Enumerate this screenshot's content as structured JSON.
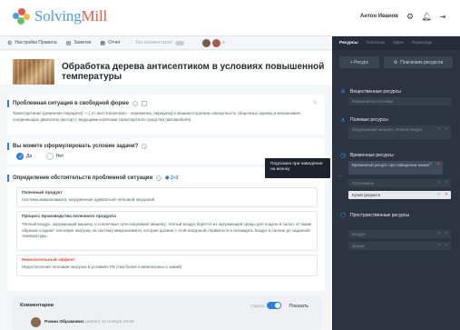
{
  "brand": {
    "name_a": "Solving",
    "name_b": "Mill"
  },
  "user": {
    "name": "Антон Иванов"
  },
  "toolbar": {
    "settings": "Настройки Правила",
    "notes": "Заметки",
    "report": "Отчет",
    "comments": "Без комментария"
  },
  "page": {
    "title": "Обработка дерева антисептиком в условиях повышенной температуры"
  },
  "problem": {
    "heading": "Проблемная ситуация в свободной форме",
    "text": "Транспортиная (ременная передача) — [ от англ.transmissio - переменна, передача] в машиностроении совокупность сборочных единиц и механизмов, соединяющих двигатель (мотор) с ведущими колёсами транспортного средства (автомобиля)."
  },
  "question": {
    "heading": "Вы можете сформулировать условие задачи?",
    "yes": "Да",
    "no": "Нет"
  },
  "circumstances": {
    "heading": "Определение обстоятельств проблемной ситуации",
    "counter": "2+3",
    "items": [
      {
        "title": "Полезный продукт",
        "text": "Система микроклимата, нагруженная адекватной тепловой нагрузкой"
      },
      {
        "title": "Процесс производства полезного продукта",
        "text": "Тёплый воздух, окружающий машину, и солнечные лучи нагревают машину; тёплый воздух берётся из окружающей среды для подачи в салон. И таким образом создают тепловую нагрузку на систему микроклимата, которая должна с этой нагрузкой справиться и охлаждать воздух в салоне до заданной температуры."
      },
      {
        "title": "Нежелательный эффект",
        "text": "Недостаточная тепловая нагрузка в условиях РБ (тем более в межсезонье и зимой)"
      }
    ]
  },
  "comments": {
    "heading": "Комментарии",
    "hide": "Скрыть",
    "show": "Показать",
    "author": "Роман Обрамович",
    "role": "(admin)",
    "date": "12 ноября 19:59"
  },
  "tooltip": {
    "text": "Подсказка при наведении на иконку"
  },
  "right_panel": {
    "tabs": [
      "Ресурсы",
      "Гипотезы",
      "Идеи",
      "Переходы"
    ],
    "add_resource": "+ Ресурс",
    "resource_finder": "Поисковик ресурсов",
    "sections": [
      {
        "title": "Вещественные ресурсы",
        "items": [
          "Компоненты системы"
        ]
      },
      {
        "title": "Полевые ресурсы",
        "items": [
          "Окружающий машину тёплый воздух"
        ]
      },
      {
        "title": "Временные ресурсы",
        "items": [
          "Временной ресурс при наведении мыши",
          "Пассажиры",
          "Кузов (редакти"
        ]
      },
      {
        "title": "Пространственные ресурсы",
        "items": [
          "Воздух",
          "Дожди"
        ]
      }
    ]
  },
  "colors": {
    "accent": "#2f7fd4",
    "danger": "#e2513f",
    "panel": "#2b3440"
  }
}
